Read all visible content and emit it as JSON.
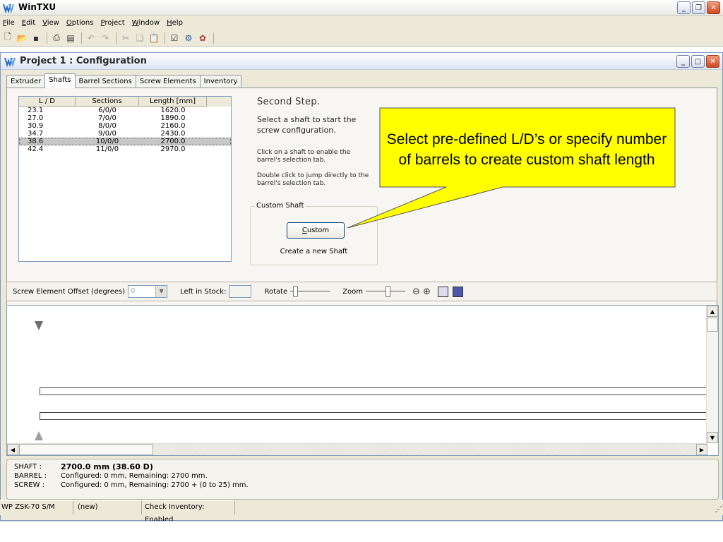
{
  "app": {
    "title": "WinTXU",
    "menu": [
      "File",
      "Edit",
      "View",
      "Options",
      "Project",
      "Window",
      "Help"
    ],
    "toolbar_icons": [
      "new-icon",
      "open-icon",
      "save-icon",
      "print-icon",
      "print-preview-icon",
      "undo-icon",
      "redo-icon",
      "cut-icon",
      "copy-icon",
      "paste-icon",
      "properties-icon",
      "configure-icon",
      "calculate-icon"
    ]
  },
  "project_window": {
    "title": "Project 1 : Configuration",
    "tabs": [
      "Extruder",
      "Shafts",
      "Barrel Sections",
      "Screw Elements",
      "Inventory"
    ],
    "active_tab": "Shafts"
  },
  "shaft_list": {
    "columns": [
      "L / D",
      "Sections",
      "Length [mm]"
    ],
    "rows": [
      {
        "ld": "23.1",
        "sections": "6/0/0",
        "length": "1620.0"
      },
      {
        "ld": "27.0",
        "sections": "7/0/0",
        "length": "1890.0"
      },
      {
        "ld": "30.9",
        "sections": "8/0/0",
        "length": "2160.0"
      },
      {
        "ld": "34.7",
        "sections": "9/0/0",
        "length": "2430.0"
      },
      {
        "ld": "38.6",
        "sections": "10/0/0",
        "length": "2700.0"
      },
      {
        "ld": "42.4",
        "sections": "11/0/0",
        "length": "2970.0"
      }
    ],
    "selected_index": 4
  },
  "instructions": {
    "title": "Second Step.",
    "text1": "Select a shaft to start the screw configuration.",
    "text2": "Click on a shaft to enable the barrel's selection tab.",
    "text3": "Double click to jump directly to the barrel's selection tab."
  },
  "custom_shaft": {
    "legend": "Custom Shaft",
    "button_label": "Custom",
    "note": "Create a new Shaft"
  },
  "callout": {
    "text": "Select pre-defined L/D’s or specify number of barrels to create custom shaft length",
    "fill": "#ffff00"
  },
  "controls": {
    "offset_label": "Screw Element Offset (degrees)",
    "offset_value": "0",
    "stock_label": "Left in Stock:",
    "rotate_label": "Rotate",
    "zoom_label": "Zoom"
  },
  "info": {
    "shaft_key": "SHAFT :",
    "shaft_value": "2700.0 mm (38.60 D)",
    "barrel_key": "BARREL :",
    "barrel_value": "Configured: 0 mm, Remaining: 2700 mm.",
    "screw_key": "SCREW :",
    "screw_value": "Configured: 0 mm, Remaining: 2700 + (0 to 25) mm."
  },
  "status": {
    "machine": "WP ZSK-70 S/M",
    "file": "(new)",
    "inventory": "Check Inventory: Enabled"
  }
}
